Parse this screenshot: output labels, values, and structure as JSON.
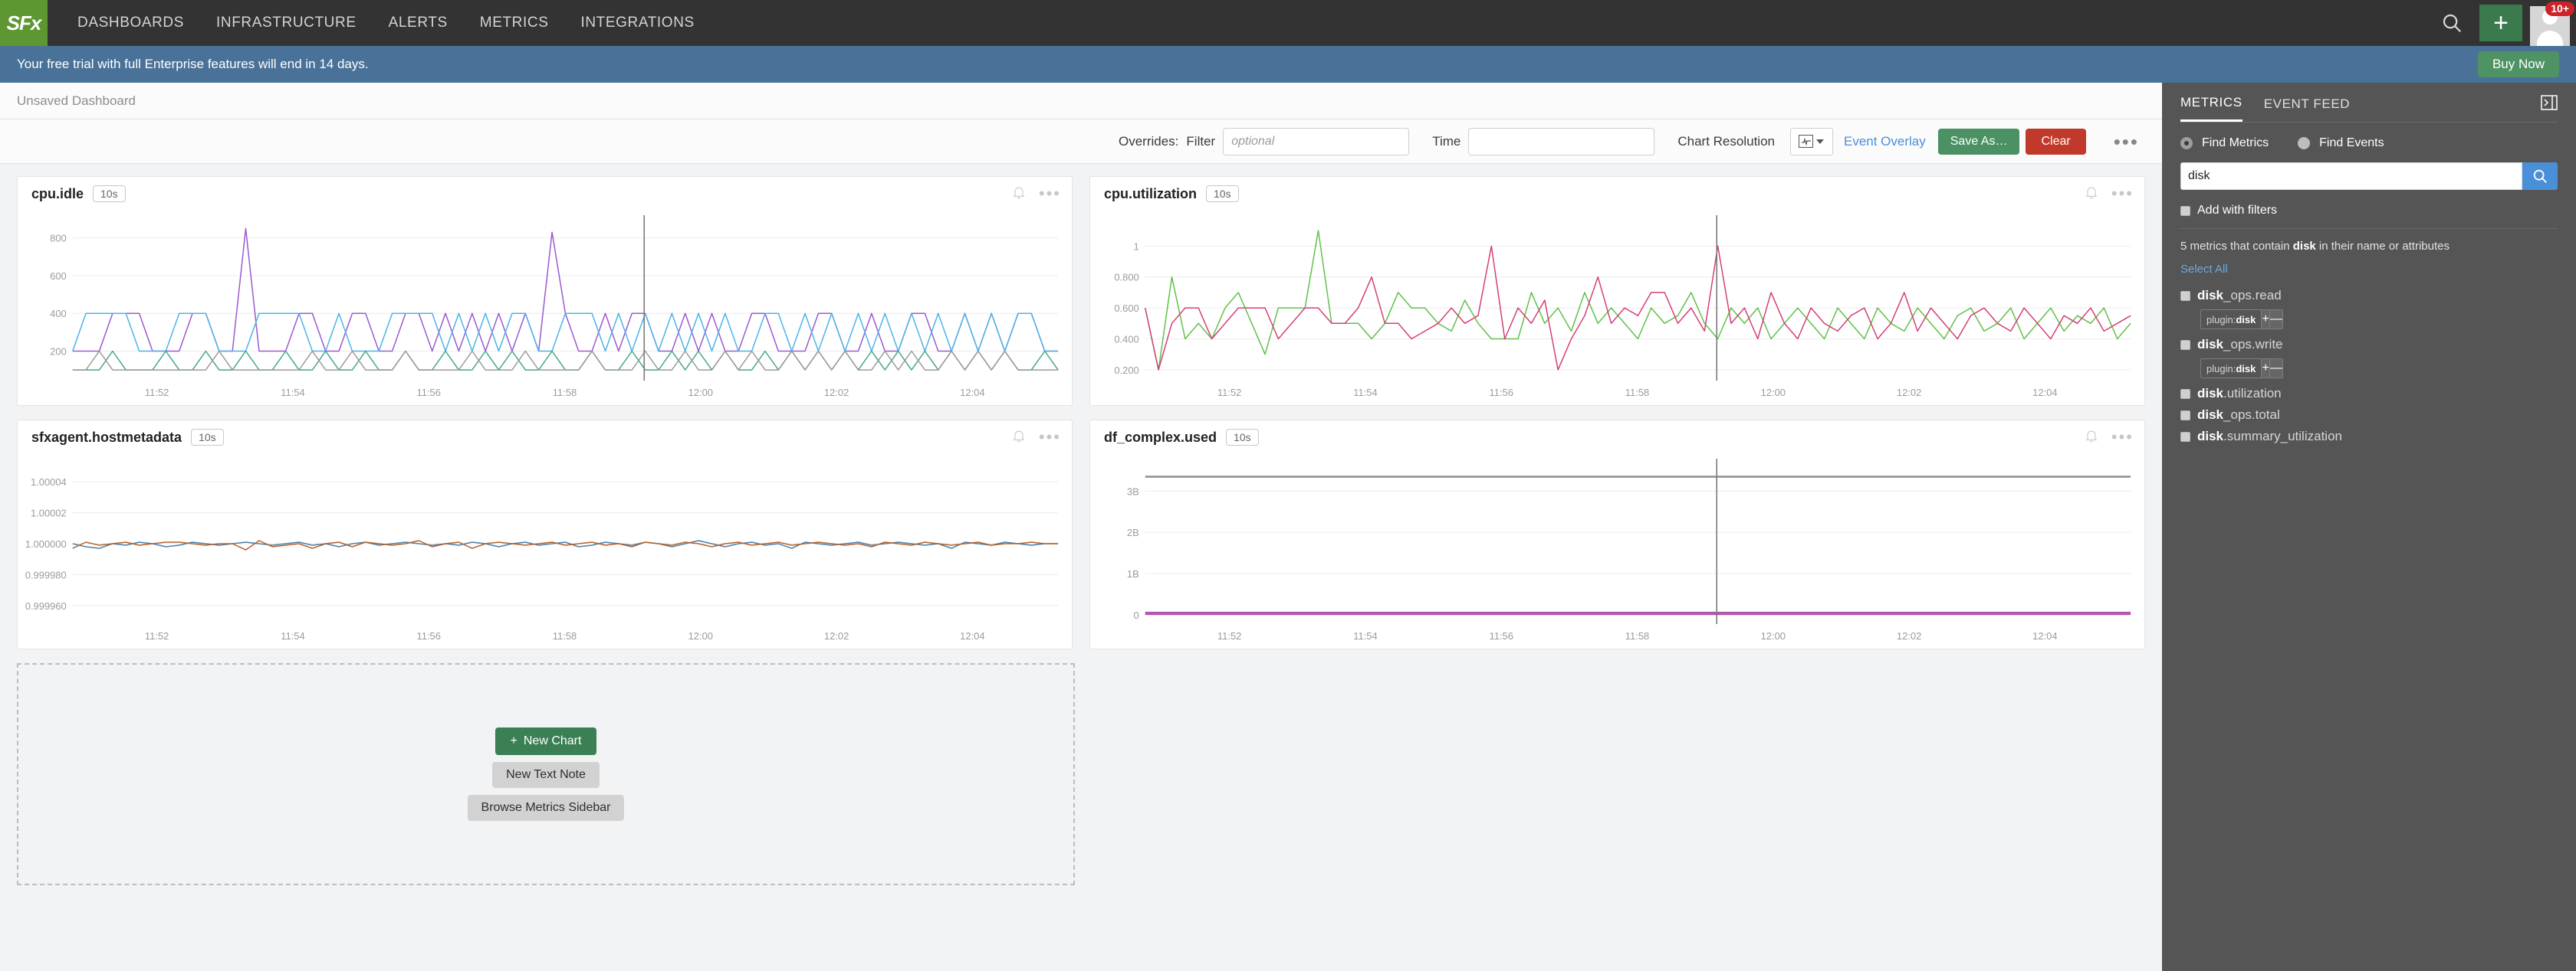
{
  "topnav": {
    "logo_text": "SFx",
    "items": [
      {
        "label": "DASHBOARDS"
      },
      {
        "label": "INFRASTRUCTURE"
      },
      {
        "label": "ALERTS"
      },
      {
        "label": "METRICS"
      },
      {
        "label": "INTEGRATIONS"
      }
    ],
    "search_icon": "search-icon",
    "add_icon": "plus-icon",
    "avatar_badge": "10+",
    "bg_color": "#333333",
    "logo_color": "#5e9732"
  },
  "trial": {
    "message": "Your free trial with full Enterprise features will end in 14 days.",
    "buy_label": "Buy Now",
    "bg_color": "#4a7298",
    "buy_color": "#4f9365"
  },
  "dashboard": {
    "title": "Unsaved Dashboard"
  },
  "toolbar": {
    "overrides_label": "Overrides:",
    "filter_label": "Filter",
    "filter_value": "",
    "filter_placeholder": "optional",
    "time_label": "Time",
    "time_value": "",
    "time_placeholder": "",
    "chart_resolution_label": "Chart Resolution",
    "event_overlay_label": "Event Overlay",
    "save_as_label": "Save As…",
    "clear_label": "Clear",
    "more_label": "•••"
  },
  "empty_panel": {
    "new_chart_label": "New Chart",
    "new_text_note_label": "New Text Note",
    "browse_metrics_label": "Browse Metrics Sidebar"
  },
  "sidebar": {
    "tabs": [
      {
        "label": "METRICS",
        "active": true
      },
      {
        "label": "EVENT FEED",
        "active": false
      }
    ],
    "collapse_icon": "collapse-panel-icon",
    "find_metrics_label": "Find Metrics",
    "find_events_label": "Find Events",
    "find_metrics_selected": true,
    "search_value": "disk",
    "search_placeholder": "",
    "add_with_filters_label": "Add with filters",
    "result_count_prefix": "5 metrics that contain ",
    "result_count_term": "disk",
    "result_count_suffix": " in their name or attributes",
    "select_all_label": "Select All",
    "metrics": [
      {
        "bold": "disk",
        "rest": "_ops.read",
        "tag": {
          "key": "plugin:",
          "value": "disk",
          "plus": "+",
          "minus": "—"
        }
      },
      {
        "bold": "disk",
        "rest": "_ops.write",
        "tag": {
          "key": "plugin:",
          "value": "disk",
          "plus": "+",
          "minus": "—"
        }
      },
      {
        "bold": "disk",
        "rest": ".utilization",
        "tag": null
      },
      {
        "bold": "disk",
        "rest": "_ops.total",
        "tag": null
      },
      {
        "bold": "disk",
        "rest": ".summary_utilization",
        "tag": null
      }
    ],
    "bg_color": "#555555",
    "accent_color": "#4a90d9"
  },
  "chart_data": [
    {
      "type": "line",
      "title": "cpu.idle",
      "resolution": "10s",
      "xlabel": "",
      "ylabel": "",
      "xticks": [
        "11:52",
        "11:54",
        "11:56",
        "11:58",
        "12:00",
        "12:02",
        "12:04"
      ],
      "yticks": [
        200,
        400,
        600,
        800
      ],
      "ylim": [
        60,
        880
      ],
      "grid": true,
      "event_overlay_x": 0.58,
      "series": [
        {
          "name": "series-purple",
          "color": "#9b59d0",
          "values": [
            200,
            200,
            200,
            400,
            400,
            400,
            200,
            200,
            200,
            400,
            400,
            200,
            200,
            850,
            200,
            200,
            200,
            400,
            400,
            200,
            200,
            400,
            400,
            200,
            200,
            400,
            400,
            200,
            400,
            200,
            400,
            200,
            400,
            200,
            400,
            200,
            830,
            400,
            200,
            200,
            400,
            200,
            400,
            400,
            200,
            200,
            400,
            200,
            400,
            200,
            200,
            400,
            400,
            200,
            200,
            200,
            400,
            400,
            200,
            200,
            400,
            200,
            200,
            400,
            400,
            200,
            200,
            400,
            200,
            400,
            200,
            400,
            400,
            200,
            200
          ]
        },
        {
          "name": "series-blue",
          "color": "#4ab4e8",
          "values": [
            200,
            400,
            400,
            400,
            400,
            200,
            200,
            200,
            400,
            400,
            400,
            200,
            200,
            200,
            400,
            400,
            400,
            400,
            200,
            200,
            400,
            200,
            200,
            200,
            400,
            400,
            400,
            400,
            200,
            400,
            200,
            400,
            200,
            400,
            400,
            200,
            200,
            400,
            400,
            400,
            200,
            400,
            200,
            400,
            200,
            400,
            200,
            400,
            200,
            400,
            200,
            200,
            400,
            400,
            200,
            400,
            200,
            400,
            200,
            400,
            200,
            400,
            200,
            400,
            200,
            400,
            200,
            400,
            200,
            400,
            200,
            400,
            400,
            200,
            200
          ]
        },
        {
          "name": "series-teal",
          "color": "#46a58a",
          "values": [
            100,
            100,
            100,
            200,
            100,
            100,
            100,
            200,
            100,
            100,
            200,
            100,
            100,
            200,
            100,
            100,
            200,
            100,
            100,
            200,
            100,
            100,
            200,
            100,
            100,
            200,
            100,
            100,
            200,
            100,
            100,
            200,
            100,
            200,
            100,
            100,
            200,
            100,
            100,
            200,
            100,
            100,
            200,
            100,
            100,
            200,
            100,
            200,
            100,
            200,
            100,
            100,
            200,
            100,
            200,
            100,
            200,
            100,
            200,
            100,
            200,
            100,
            200,
            100,
            200,
            100,
            200,
            100,
            200,
            100,
            200,
            100,
            100,
            200,
            100
          ]
        },
        {
          "name": "series-gray",
          "color": "#9a9a9a",
          "values": [
            100,
            100,
            200,
            100,
            100,
            100,
            100,
            100,
            100,
            100,
            100,
            200,
            100,
            100,
            100,
            100,
            100,
            100,
            200,
            100,
            100,
            200,
            100,
            100,
            100,
            200,
            100,
            100,
            100,
            100,
            200,
            100,
            100,
            100,
            200,
            100,
            100,
            100,
            100,
            200,
            100,
            100,
            100,
            200,
            100,
            100,
            200,
            100,
            100,
            200,
            100,
            200,
            100,
            100,
            200,
            100,
            200,
            100,
            200,
            100,
            100,
            200,
            100,
            200,
            100,
            100,
            200,
            100,
            200,
            100,
            200,
            100,
            100,
            100,
            100
          ]
        }
      ]
    },
    {
      "type": "line",
      "title": "cpu.utilization",
      "resolution": "10s",
      "xlabel": "",
      "ylabel": "",
      "xticks": [
        "11:52",
        "11:54",
        "11:56",
        "11:58",
        "12:00",
        "12:02",
        "12:04"
      ],
      "yticks": [
        "0.200",
        "0.400",
        "0.600",
        "0.800",
        "1"
      ],
      "ylim": [
        0.15,
        1.15
      ],
      "grid": true,
      "event_overlay_x": 0.58,
      "series": [
        {
          "name": "series-green",
          "color": "#61c04a",
          "values": [
            0.6,
            0.2,
            0.8,
            0.4,
            0.5,
            0.4,
            0.6,
            0.7,
            0.5,
            0.3,
            0.6,
            0.6,
            0.6,
            1.1,
            0.5,
            0.5,
            0.5,
            0.4,
            0.5,
            0.7,
            0.6,
            0.6,
            0.5,
            0.45,
            0.65,
            0.5,
            0.4,
            0.4,
            0.4,
            0.7,
            0.5,
            0.6,
            0.45,
            0.7,
            0.5,
            0.6,
            0.5,
            0.4,
            0.6,
            0.5,
            0.55,
            0.7,
            0.5,
            0.4,
            0.6,
            0.5,
            0.6,
            0.4,
            0.5,
            0.6,
            0.5,
            0.4,
            0.6,
            0.5,
            0.4,
            0.6,
            0.5,
            0.45,
            0.6,
            0.5,
            0.4,
            0.55,
            0.6,
            0.45,
            0.5,
            0.6,
            0.4,
            0.5,
            0.6,
            0.45,
            0.55,
            0.5,
            0.6,
            0.4,
            0.5
          ]
        },
        {
          "name": "series-pink",
          "color": "#d43f78",
          "values": [
            0.6,
            0.2,
            0.5,
            0.6,
            0.6,
            0.4,
            0.5,
            0.6,
            0.6,
            0.6,
            0.4,
            0.5,
            0.6,
            0.6,
            0.5,
            0.5,
            0.6,
            0.8,
            0.5,
            0.5,
            0.4,
            0.45,
            0.5,
            0.6,
            0.5,
            0.55,
            1.0,
            0.4,
            0.6,
            0.5,
            0.65,
            0.2,
            0.4,
            0.55,
            0.8,
            0.5,
            0.6,
            0.55,
            0.7,
            0.7,
            0.5,
            0.6,
            0.45,
            1.0,
            0.5,
            0.6,
            0.4,
            0.7,
            0.5,
            0.4,
            0.6,
            0.5,
            0.45,
            0.55,
            0.6,
            0.4,
            0.5,
            0.7,
            0.45,
            0.6,
            0.5,
            0.4,
            0.55,
            0.6,
            0.5,
            0.45,
            0.6,
            0.5,
            0.4,
            0.55,
            0.5,
            0.6,
            0.45,
            0.5,
            0.55
          ]
        }
      ]
    },
    {
      "type": "line",
      "title": "sfxagent.hostmetadata",
      "resolution": "10s",
      "xlabel": "",
      "ylabel": "",
      "xticks": [
        "11:52",
        "11:54",
        "11:56",
        "11:58",
        "12:00",
        "12:02",
        "12:04"
      ],
      "yticks": [
        "1.00004",
        "1.00002",
        "1.000000",
        "0.999980",
        "0.999960"
      ],
      "ylim": [
        0.99995,
        1.00005
      ],
      "grid": true,
      "event_overlay_x": null,
      "series": [
        {
          "name": "series-blue",
          "color": "#4d7fa8",
          "values": [
            1.0,
            0.999998,
            0.999997,
            1.0,
            0.999999,
            1.000001,
            1.0,
            0.999998,
            0.999999,
            1.000001,
            1.0,
            0.999999,
            1.0,
            1.000001,
            1.0,
            0.999999,
            1.0,
            1.000001,
            0.999999,
            1.0,
            0.999998,
            1.0,
            1.000001,
            0.999999,
            1.0,
            1.000001,
            1.0,
            0.999999,
            1.0,
            0.999999,
            1.000001,
            1.0,
            0.999998,
            1.0,
            1.000001,
            0.999999,
            1.0,
            1.000001,
            0.999998,
            0.999999,
            1.000001,
            1.0,
            0.999999,
            1.000001,
            1.0,
            0.999998,
            1.0,
            1.000002,
            1.0,
            0.999998,
            1.0,
            1.000001,
            0.999999,
            1.0,
            0.999997,
            1.000001,
            1.0,
            0.999999,
            1.0,
            1.000001,
            0.999999,
            1.0,
            1.000001,
            1.0,
            0.999999,
            1.0,
            0.999997,
            1.000001,
            1.0,
            0.999999,
            1.000001,
            1.0,
            0.999999,
            1.0,
            1.0
          ]
        },
        {
          "name": "series-brown",
          "color": "#b5622c",
          "values": [
            0.999997,
            1.000001,
            0.999999,
            1.0,
            1.000001,
            0.999999,
            1.0,
            1.000001,
            1.000001,
            1.0,
            0.999999,
            1.0,
            1.0,
            0.999996,
            1.000002,
            0.999998,
            0.999999,
            1.0,
            0.999997,
            1.0,
            1.000001,
            0.999998,
            1.000001,
            1.0,
            0.999999,
            1.0,
            1.000002,
            0.999998,
            1.0,
            1.000001,
            0.999997,
            1.0,
            1.000001,
            1.0,
            0.999999,
            1.0,
            1.000001,
            0.999999,
            1.0,
            1.000001,
            0.999999,
            1.0,
            0.999998,
            1.000001,
            1.0,
            0.999999,
            1.000001,
            1.0,
            0.999998,
            1.0,
            1.000001,
            0.999999,
            1.0,
            1.000001,
            0.999999,
            1.0,
            1.000001,
            1.0,
            0.999999,
            1.0,
            0.999998,
            1.000001,
            1.0,
            0.999999,
            1.000001,
            1.0,
            0.999999,
            1.0,
            1.000001,
            0.999999,
            1.0,
            1.0,
            1.000001,
            1.0,
            1.0
          ]
        }
      ]
    },
    {
      "type": "line",
      "title": "df_complex.used",
      "resolution": "10s",
      "xlabel": "",
      "ylabel": "",
      "xticks": [
        "11:52",
        "11:54",
        "11:56",
        "11:58",
        "12:00",
        "12:02",
        "12:04"
      ],
      "yticks": [
        "0",
        "1B",
        "2B",
        "3B"
      ],
      "ylim": [
        -0.15,
        3.6
      ],
      "grid": true,
      "event_overlay_x": 0.58,
      "series": [
        {
          "name": "series-gray-flat",
          "color": "#8d8d8d",
          "constant": 3.35
        },
        {
          "name": "series-purple-flat",
          "color": "#a05ca8",
          "constant": 0.05
        },
        {
          "name": "series-magenta-flat",
          "color": "#c64fb0",
          "constant": 0.02
        }
      ]
    }
  ]
}
